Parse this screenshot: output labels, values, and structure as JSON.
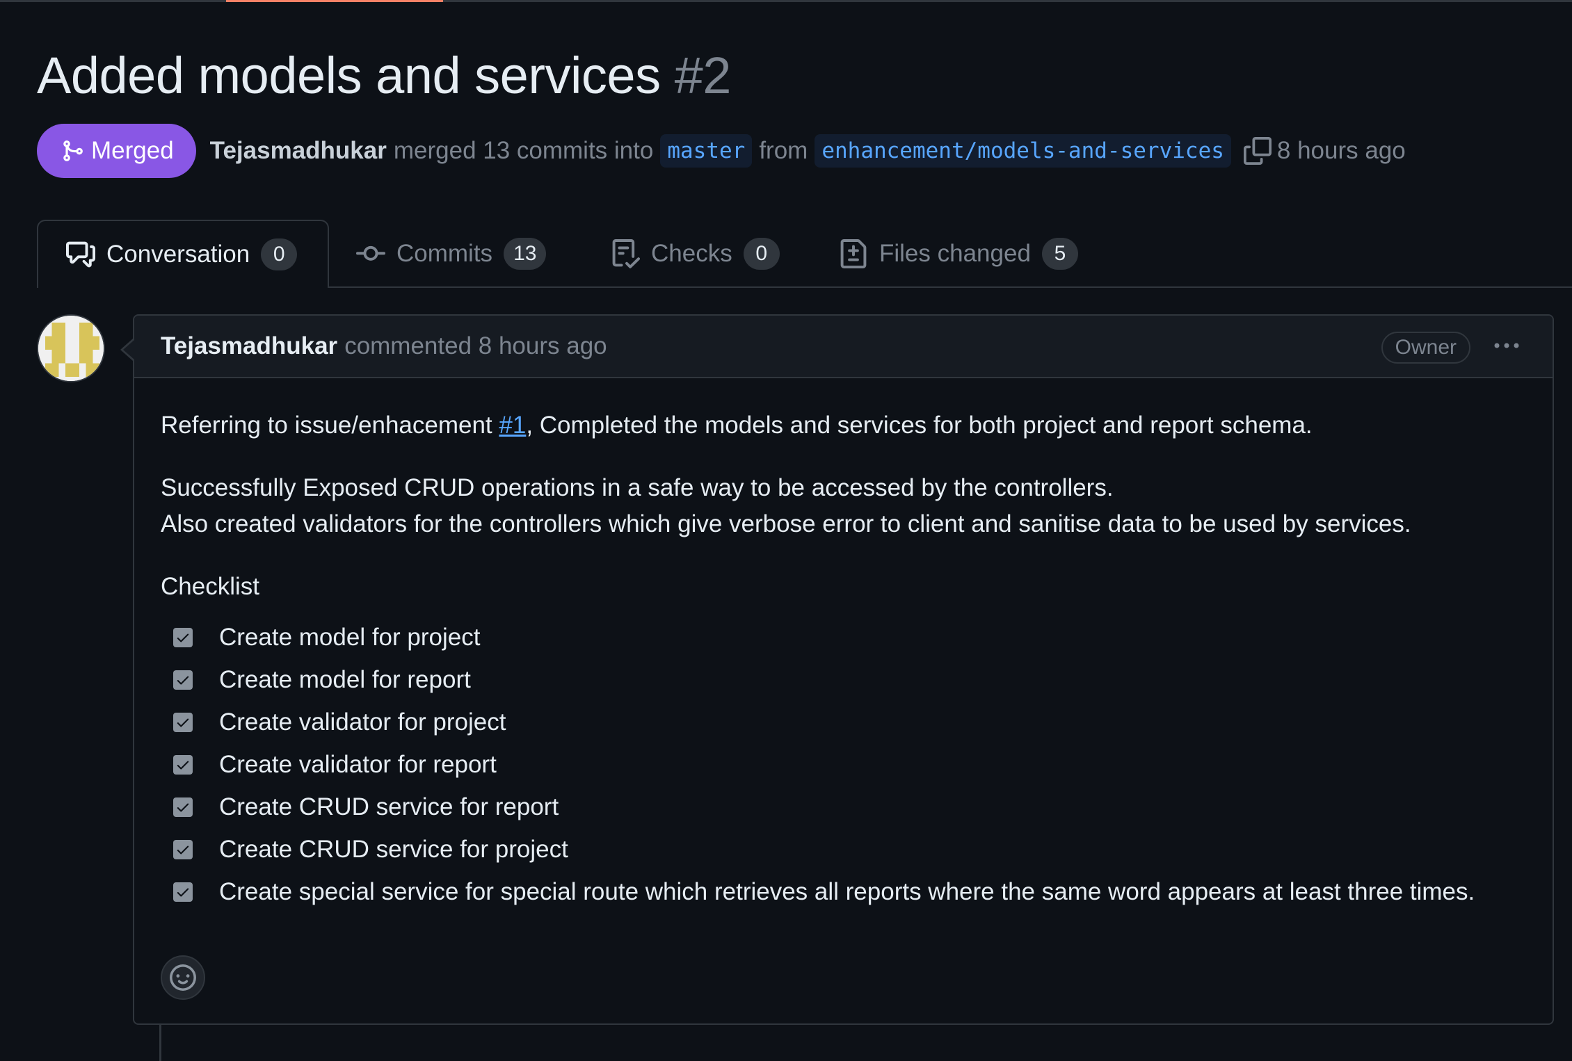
{
  "pr": {
    "title": "Added models and services",
    "number": "#2",
    "state_label": "Merged",
    "author": "Tejasmadhukar",
    "summary_merged": "merged 13 commits into",
    "base_branch": "master",
    "from_text": "from",
    "head_branch": "enhancement/models-and-services",
    "time": "8 hours ago"
  },
  "tabs": [
    {
      "label": "Conversation",
      "count": "0",
      "icon": "comment-discussion-icon",
      "active": true
    },
    {
      "label": "Commits",
      "count": "13",
      "icon": "git-commit-icon",
      "active": false
    },
    {
      "label": "Checks",
      "count": "0",
      "icon": "checklist-icon",
      "active": false
    },
    {
      "label": "Files changed",
      "count": "5",
      "icon": "file-diff-icon",
      "active": false
    }
  ],
  "comment": {
    "author": "Tejasmadhukar",
    "action": "commented 8 hours ago",
    "role_badge": "Owner",
    "para1_before": "Referring to issue/enhacement ",
    "para1_link": "#1",
    "para1_after": ", Completed the models and services for both project and report schema.",
    "para2_line1": "Successfully Exposed CRUD operations in a safe way to be accessed by the controllers.",
    "para2_line2": "Also created validators for the controllers which give verbose error to client and sanitise data to be used by services.",
    "checklist_heading": "Checklist",
    "checklist": [
      {
        "label": "Create model for project",
        "checked": true
      },
      {
        "label": "Create model for report",
        "checked": true
      },
      {
        "label": "Create validator for project",
        "checked": true
      },
      {
        "label": "Create validator for report",
        "checked": true
      },
      {
        "label": "Create CRUD service for report",
        "checked": true
      },
      {
        "label": "Create CRUD service for project",
        "checked": true
      },
      {
        "label": "Create special service for special route which retrieves all reports where the same word appears at least three times.",
        "checked": true
      }
    ]
  },
  "colors": {
    "background": "#0d1117",
    "merged": "#8957e5",
    "link": "#58a6ff",
    "accent_underline": "#f78166"
  }
}
